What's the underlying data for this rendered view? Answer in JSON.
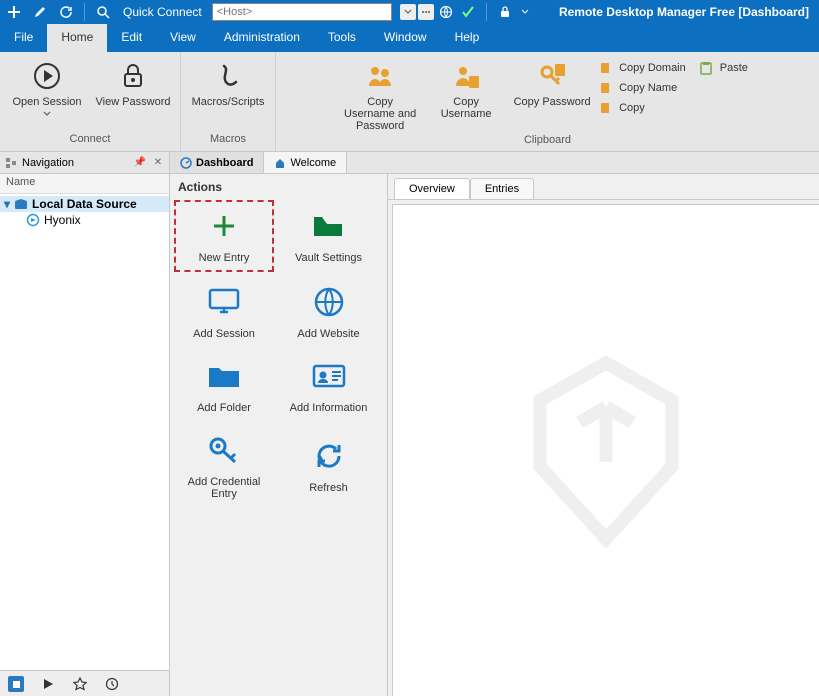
{
  "title": "Remote Desktop Manager Free [Dashboard]",
  "quick_connect": {
    "label": "Quick Connect",
    "placeholder": "<Host>"
  },
  "menu": {
    "file": "File",
    "home": "Home",
    "edit": "Edit",
    "view": "View",
    "administration": "Administration",
    "tools": "Tools",
    "window": "Window",
    "help": "Help"
  },
  "ribbon": {
    "connect": {
      "label": "Connect",
      "open_session": "Open Session",
      "view_password": "View Password"
    },
    "macros": {
      "label": "Macros",
      "macros_scripts": "Macros/Scripts"
    },
    "clipboard": {
      "label": "Clipboard",
      "copy_user_pass": "Copy Username and Password",
      "copy_username": "Copy Username",
      "copy_password": "Copy Password",
      "copy_domain": "Copy Domain",
      "copy_name": "Copy Name",
      "copy": "Copy",
      "paste": "Paste"
    }
  },
  "navigation": {
    "title": "Navigation",
    "column": "Name",
    "root": "Local Data Source",
    "item1": "Hyonix"
  },
  "doc_tabs": {
    "dashboard": "Dashboard",
    "welcome": "Welcome"
  },
  "actions": {
    "title": "Actions",
    "new_entry": "New Entry",
    "vault_settings": "Vault Settings",
    "add_session": "Add Session",
    "add_website": "Add Website",
    "add_folder": "Add Folder",
    "add_information": "Add Information",
    "add_credential": "Add Credential Entry",
    "refresh": "Refresh"
  },
  "preview_tabs": {
    "overview": "Overview",
    "entries": "Entries"
  }
}
